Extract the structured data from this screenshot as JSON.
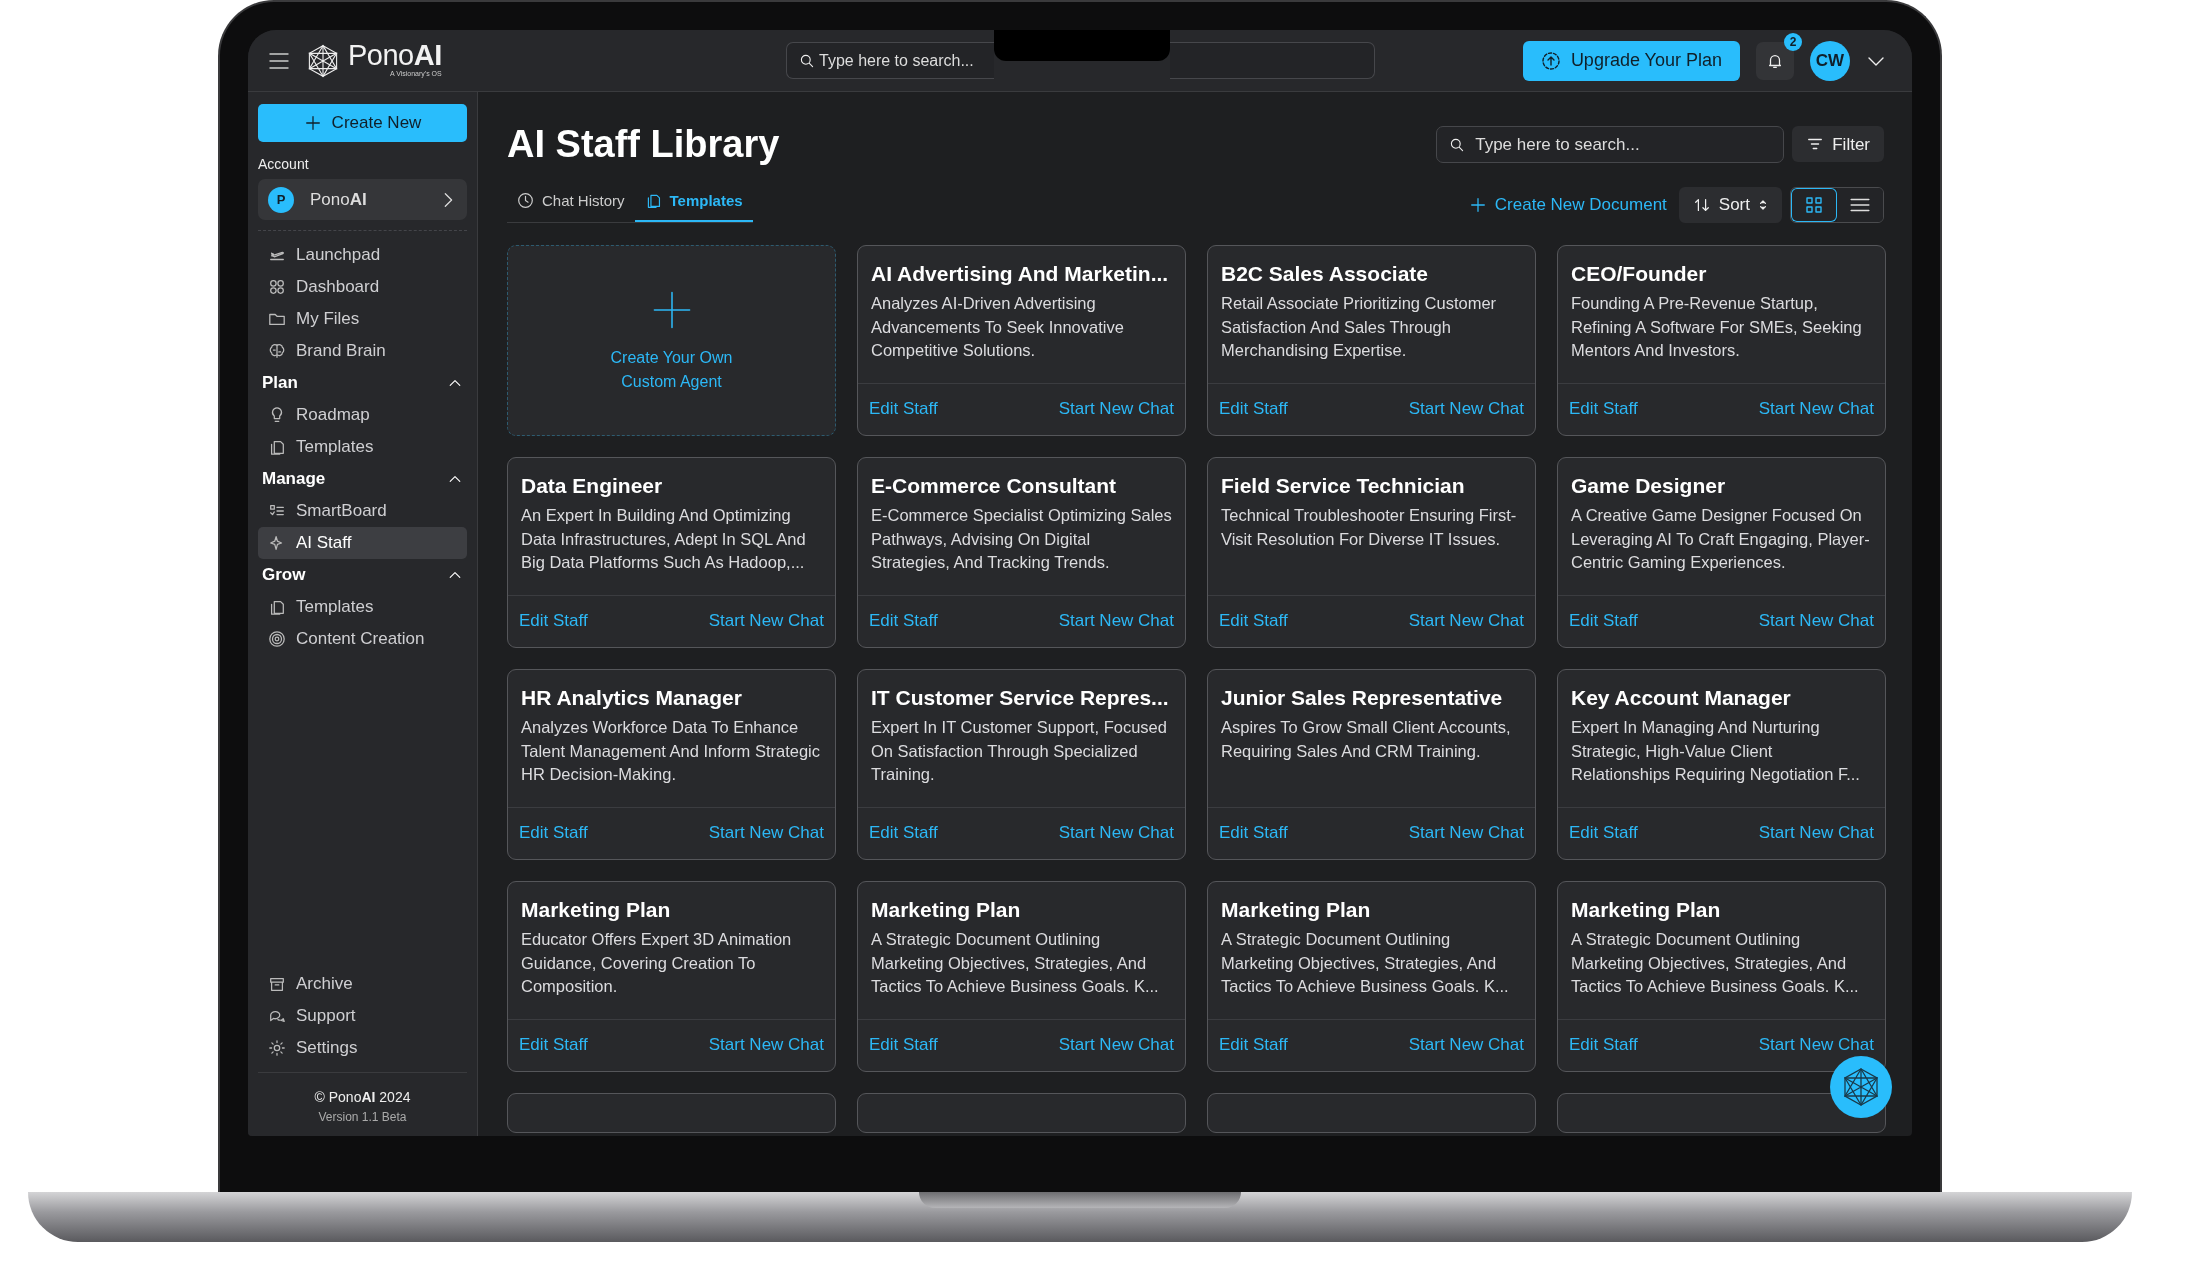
{
  "header": {
    "brand": "Pono**AI**",
    "tagline": "A Visionary's OS",
    "search": {
      "placeholder": "Type here to search..."
    },
    "upgrade_button": "Upgrade Your Plan",
    "notification_count": "2",
    "avatar_initials": "CW"
  },
  "sidebar": {
    "create_button": "Create New",
    "account_label": "Account",
    "account": {
      "initial": "P",
      "name": "Pono**AI**"
    },
    "items": [
      {
        "label": "Launchpad",
        "selected": false
      },
      {
        "label": "Dashboard",
        "selected": false
      },
      {
        "label": "My Files",
        "selected": false
      },
      {
        "label": "Brand Brain",
        "selected": false
      }
    ],
    "sections": [
      {
        "title": "Plan",
        "expanded": true,
        "items": [
          {
            "label": "Roadmap",
            "selected": false
          },
          {
            "label": "Templates",
            "selected": false
          }
        ]
      },
      {
        "title": "Manage",
        "expanded": true,
        "items": [
          {
            "label": "SmartBoard",
            "selected": false
          },
          {
            "label": "AI Staff",
            "selected": true
          }
        ]
      },
      {
        "title": "Grow",
        "expanded": true,
        "items": [
          {
            "label": "Templates",
            "selected": false
          },
          {
            "label": "Content Creation",
            "selected": false
          }
        ]
      }
    ],
    "bottom_items": [
      {
        "label": "Archive",
        "selected": false
      },
      {
        "label": "Support",
        "selected": false
      },
      {
        "label": "Settings",
        "selected": false
      }
    ],
    "footer": {
      "copyright": "© Pono**AI** 2024",
      "version": "Version 1.1 Beta"
    }
  },
  "main": {
    "title": "AI Staff Library",
    "search": {
      "placeholder": "Type here to search..."
    },
    "filter_button": "Filter",
    "tabs": [
      {
        "label": "Chat History",
        "selected": false
      },
      {
        "label": "Templates",
        "selected": true
      }
    ],
    "create_document": "Create New Document",
    "sort_button": "Sort",
    "view_modes": [
      {
        "kind": "grid",
        "selected": true
      },
      {
        "kind": "list",
        "selected": false
      }
    ],
    "create_card": {
      "label": "Create Your Own Custom Agent"
    },
    "cards": [
      {
        "kind": "staff",
        "title": "AI Advertising And Marketin...",
        "description": "Analyzes AI-Driven Advertising Advancements To Seek Innovative Competitive Solutions.",
        "edit": "Edit Staff",
        "chat": "Start New Chat"
      },
      {
        "kind": "staff",
        "title": "B2C Sales Associate",
        "description": "Retail Associate Prioritizing Customer Satisfaction And Sales Through Merchandising Expertise.",
        "edit": "Edit Staff",
        "chat": "Start New Chat"
      },
      {
        "kind": "staff",
        "title": "CEO/Founder",
        "description": "Founding A Pre-Revenue Startup, Refining A Software For SMEs, Seeking Mentors And Investors.",
        "edit": "Edit Staff",
        "chat": "Start New Chat"
      },
      {
        "kind": "staff",
        "title": "Data Engineer",
        "description": "An Expert In Building And Optimizing Data Infrastructures, Adept In SQL And Big Data Platforms Such As Hadoop,...",
        "edit": "Edit Staff",
        "chat": "Start New Chat"
      },
      {
        "kind": "staff",
        "title": "E-Commerce Consultant",
        "description": "E-Commerce Specialist Optimizing Sales Pathways, Advising On Digital Strategies, And Tracking Trends.",
        "edit": "Edit Staff",
        "chat": "Start New Chat"
      },
      {
        "kind": "staff",
        "title": "Field Service Technician",
        "description": "Technical Troubleshooter Ensuring First-Visit Resolution For Diverse IT Issues.",
        "edit": "Edit Staff",
        "chat": "Start New Chat"
      },
      {
        "kind": "staff",
        "title": "Game Designer",
        "description": "A Creative Game Designer Focused On Leveraging AI To Craft Engaging, Player-Centric Gaming Experiences.",
        "edit": "Edit Staff",
        "chat": "Start New Chat"
      },
      {
        "kind": "staff",
        "title": "HR Analytics Manager",
        "description": "Analyzes Workforce Data To Enhance Talent Management And Inform Strategic HR Decision-Making.",
        "edit": "Edit Staff",
        "chat": "Start New Chat"
      },
      {
        "kind": "staff",
        "title": "IT Customer Service Repres...",
        "description": "Expert In IT Customer Support, Focused On Satisfaction Through Specialized Training.",
        "edit": "Edit Staff",
        "chat": "Start New Chat"
      },
      {
        "kind": "staff",
        "title": "Junior Sales Representative",
        "description": "Aspires To Grow Small Client Accounts, Requiring Sales And CRM Training.",
        "edit": "Edit Staff",
        "chat": "Start New Chat"
      },
      {
        "kind": "staff",
        "title": "Key Account Manager",
        "description": "Expert In Managing And Nurturing Strategic, High-Value Client Relationships Requiring Negotiation F...",
        "edit": "Edit Staff",
        "chat": "Start New Chat"
      },
      {
        "kind": "staff",
        "title": "Marketing Plan",
        "description": "Educator Offers Expert 3D Animation Guidance, Covering Creation To Composition.",
        "edit": "Edit Staff",
        "chat": "Start New Chat"
      },
      {
        "kind": "staff",
        "title": "Marketing Plan",
        "description": "A Strategic Document Outlining Marketing Objectives, Strategies, And Tactics To Achieve Business Goals. K...",
        "edit": "Edit Staff",
        "chat": "Start New Chat"
      },
      {
        "kind": "staff",
        "title": "Marketing Plan",
        "description": "A Strategic Document Outlining Marketing Objectives, Strategies, And Tactics To Achieve Business Goals. K...",
        "edit": "Edit Staff",
        "chat": "Start New Chat"
      },
      {
        "kind": "staff",
        "title": "Marketing Plan",
        "description": "A Strategic Document Outlining Marketing Objectives, Strategies, And Tactics To Achieve Business Goals. K...",
        "edit": "Edit Staff",
        "chat": "Start New Chat"
      },
      {
        "kind": "stub"
      },
      {
        "kind": "stub"
      },
      {
        "kind": "stub"
      },
      {
        "kind": "stub"
      }
    ]
  }
}
